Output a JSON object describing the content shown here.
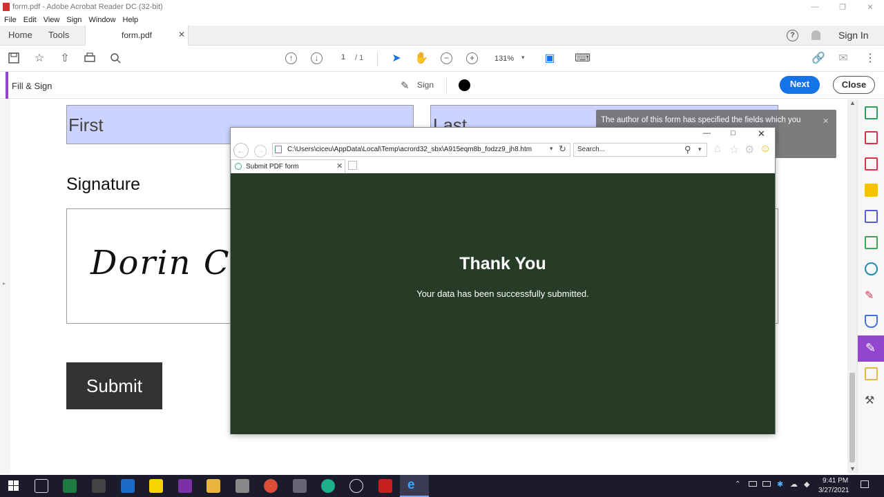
{
  "window": {
    "title": "form.pdf - Adobe Acrobat Reader DC (32-bit)"
  },
  "menu": [
    "File",
    "Edit",
    "View",
    "Sign",
    "Window",
    "Help"
  ],
  "tabs": {
    "home": "Home",
    "tools": "Tools",
    "document": "form.pdf",
    "sign_in": "Sign In"
  },
  "toolbar": {
    "page_current": "1",
    "page_total": "/ 1",
    "zoom": "131%"
  },
  "fill_sign": {
    "title": "Fill & Sign",
    "sign_label": "Sign",
    "next_label": "Next",
    "close_label": "Close"
  },
  "pdf_form": {
    "first_field": "First",
    "last_field": "Last",
    "signature_heading": "Signature",
    "signature_value": "Dorin Cic",
    "submit_label": "Submit"
  },
  "notice": {
    "text": "The author of this form has specified the fields which you"
  },
  "ie_window": {
    "address": "C:\\Users\\ciceu\\AppData\\Local\\Temp\\acrord32_sbx\\A915eqm8b_fodzz9_jh8.htm",
    "search_placeholder": "Search...",
    "tab_title": "Submit PDF form",
    "heading": "Thank You",
    "message": "Your data has been successfully submitted.",
    "background_color": "#263c27"
  },
  "taskbar": {
    "time": "9:41 PM",
    "date": "3/27/2021"
  },
  "colors": {
    "accent_blue": "#1473e6",
    "fill_sign_purple": "#9246d0"
  }
}
